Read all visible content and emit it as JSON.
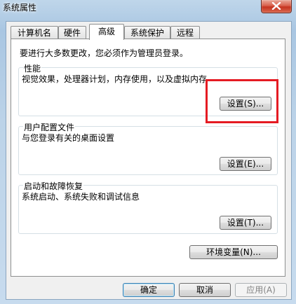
{
  "window": {
    "title": "系统属性"
  },
  "tabs": [
    {
      "label": "计算机名",
      "active": false
    },
    {
      "label": "硬件",
      "active": false
    },
    {
      "label": "高级",
      "active": true
    },
    {
      "label": "系统保护",
      "active": false
    },
    {
      "label": "远程",
      "active": false
    }
  ],
  "notice": "要进行大多数更改，您必须作为管理员登录。",
  "performance": {
    "title": "性能",
    "description": "视觉效果，处理器计划，内存使用，以及虚拟内存",
    "button": "设置(S)..."
  },
  "user_profiles": {
    "title": "用户配置文件",
    "description": "与您登录有关的桌面设置",
    "button": "设置(E)..."
  },
  "startup_recovery": {
    "title": "启动和故障恢复",
    "description": "系统启动、系统失败和调试信息",
    "button": "设置(T)..."
  },
  "env_button": "环境变量(N)...",
  "footer": {
    "ok": "确定",
    "cancel": "取消",
    "apply": "应用(A)"
  },
  "colors": {
    "highlight": "#e51b23",
    "close_button": "#c5331f"
  }
}
